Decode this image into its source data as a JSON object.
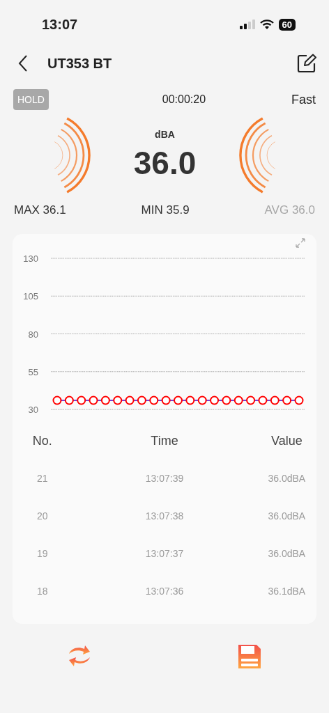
{
  "status_bar": {
    "time": "13:07",
    "battery": "60"
  },
  "header": {
    "title": "UT353 BT"
  },
  "info": {
    "hold": {
      "label": "HOLD",
      "active": false
    },
    "timer": "00:00:20",
    "mode": "Fast"
  },
  "reading": {
    "unit": "dBA",
    "value": "36.0"
  },
  "stats": [
    {
      "text": "MAX 36.1",
      "dimmed": false
    },
    {
      "text": "MIN 35.9",
      "dimmed": false
    },
    {
      "text": "AVG 36.0",
      "dimmed": true
    }
  ],
  "chart": {
    "chart_data": {
      "type": "line",
      "ylim": [
        30,
        130
      ],
      "yticks": [
        30,
        55,
        80,
        105,
        130
      ],
      "grid": true,
      "series": [
        {
          "color": "#7b3fd0",
          "marker": "circle",
          "values": [
            36,
            36,
            36,
            36,
            36,
            36,
            36,
            36,
            36,
            36,
            36,
            36,
            36,
            36,
            36,
            36,
            36,
            36,
            36,
            36,
            36
          ]
        }
      ]
    }
  },
  "table": {
    "columns": [
      "No.",
      "Time",
      "Value"
    ],
    "rows": [
      [
        "21",
        "13:07:39",
        "36.0dBA"
      ],
      [
        "20",
        "13:07:38",
        "36.0dBA"
      ],
      [
        "19",
        "13:07:37",
        "36.0dBA"
      ],
      [
        "18",
        "13:07:36",
        "36.1dBA"
      ]
    ]
  }
}
